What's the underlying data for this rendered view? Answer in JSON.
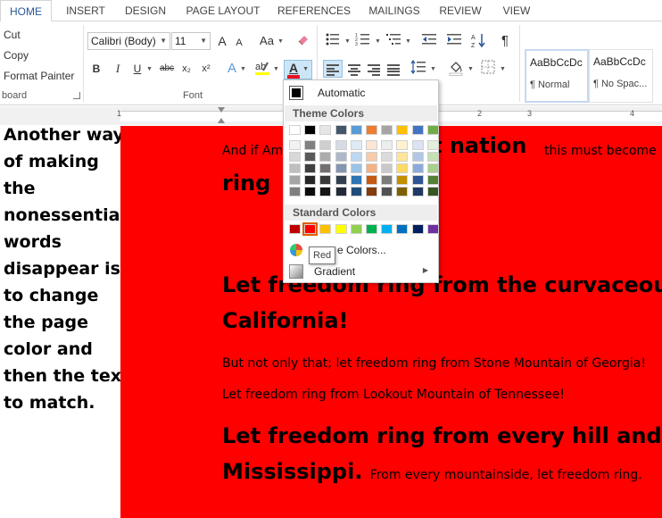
{
  "tabs": [
    "HOME",
    "INSERT",
    "DESIGN",
    "PAGE LAYOUT",
    "REFERENCES",
    "MAILINGS",
    "REVIEW",
    "VIEW"
  ],
  "clipboard": {
    "cut": "Cut",
    "copy": "Copy",
    "format_painter": "Format Painter",
    "group_label": "board"
  },
  "font": {
    "name": "Calibri (Body)",
    "size": "11",
    "group_label": "Font",
    "grow_label": "A",
    "shrink_label": "A",
    "case_label": "Aa",
    "bold": "B",
    "italic": "I",
    "underline": "U",
    "strike": "abc",
    "subscript": "x₂",
    "superscript": "x²",
    "text_effects": "A",
    "font_color_label": "A",
    "font_color": "#e81123"
  },
  "styles": [
    {
      "sample": "AaBbCcDc",
      "name": "¶ Normal"
    },
    {
      "sample": "AaBbCcDc",
      "name": "¶ No Spac..."
    }
  ],
  "ruler_numbers": [
    "1",
    "1",
    "2",
    "3",
    "4"
  ],
  "annotation": "Another way of making the nonessential words disappear is to change the page color and then the text to match.",
  "annotation_lines": [
    "Another way",
    "of making",
    "the",
    "nonessential",
    "words",
    "disappear is",
    "to change",
    "the page",
    "color and",
    "then the text",
    "to match."
  ],
  "document": {
    "page_color": "#ff0000",
    "line1_small": "And if Am",
    "line1_big": "t nation",
    "line1_tail": "this must become",
    "line2": "ring",
    "h1_line1": "Let freedom ring from the curvaceous",
    "h1_line2": "California!",
    "p1": "But not only that; let freedom ring from Stone Mountain of Georgia!",
    "p2": "Let freedom ring from Lookout Mountain of Tennessee!",
    "h2_line1": "Let freedom ring from every hill and m",
    "h2_line2": "Mississippi.",
    "h2_tail": "From every mountainside, let freedom ring."
  },
  "color_menu": {
    "automatic": "Automatic",
    "theme_header": "Theme Colors",
    "standard_header": "Standard Colors",
    "more_colors": "More Colors...",
    "more_colors_visible": "e Colors...",
    "gradient": "Gradient",
    "tooltip": "Red",
    "theme_top": [
      "#ffffff",
      "#000000",
      "#e7e6e6",
      "#44546a",
      "#5b9bd5",
      "#ed7d31",
      "#a5a5a5",
      "#ffc000",
      "#4472c4",
      "#70ad47"
    ],
    "theme_shades": [
      [
        "#f2f2f2",
        "#7f7f7f",
        "#d0cece",
        "#d6dce4",
        "#deebf6",
        "#fbe5d5",
        "#ededed",
        "#fff2cc",
        "#dae3f3",
        "#e2efd9"
      ],
      [
        "#d8d8d8",
        "#595959",
        "#aeabab",
        "#adb9ca",
        "#bdd7ee",
        "#f7cbac",
        "#dbdbdb",
        "#fee599",
        "#b4c6e7",
        "#c5e0b3"
      ],
      [
        "#bfbfbf",
        "#3f3f3f",
        "#757070",
        "#8496b0",
        "#9cc3e5",
        "#f4b183",
        "#c9c9c9",
        "#ffd965",
        "#8eaadb",
        "#a8d08d"
      ],
      [
        "#a5a5a5",
        "#262626",
        "#3a3838",
        "#323f4f",
        "#2e75b5",
        "#c55a11",
        "#7b7b7b",
        "#bf9000",
        "#2f5496",
        "#538135"
      ],
      [
        "#7f7f7f",
        "#0c0c0c",
        "#171616",
        "#222a35",
        "#1f4e79",
        "#833c0b",
        "#525252",
        "#7f6000",
        "#1f3864",
        "#375623"
      ]
    ],
    "standard": [
      "#c00000",
      "#ff0000",
      "#ffc000",
      "#ffff00",
      "#92d050",
      "#00b050",
      "#00b0f0",
      "#0070c0",
      "#002060",
      "#7030a0"
    ],
    "selected_standard_index": 1
  }
}
